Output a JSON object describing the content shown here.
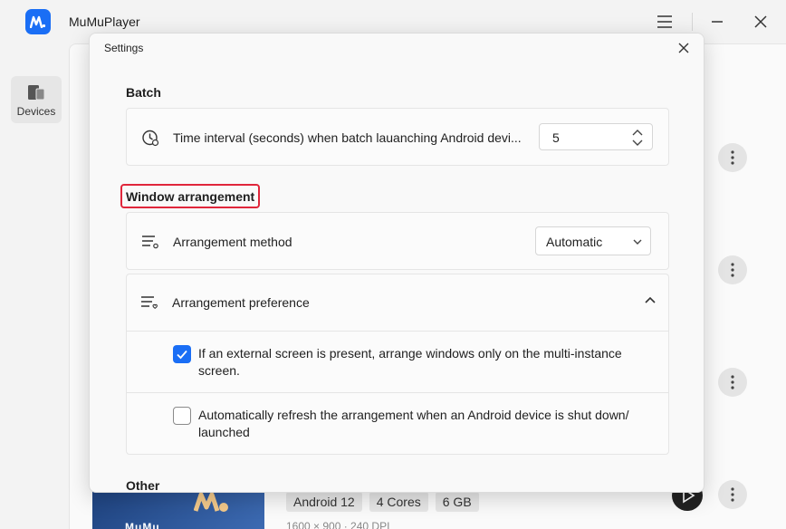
{
  "app": {
    "title": "MuMuPlayer",
    "sidebar": {
      "devices_label": "Devices"
    },
    "device": {
      "chips": [
        "Android 12",
        "4 Cores",
        "6 GB"
      ],
      "meta": "1600 × 900 · 240 DPI",
      "thumb_text": "MuMu"
    }
  },
  "settings": {
    "title": "Settings",
    "batch": {
      "heading": "Batch",
      "interval_label": "Time interval (seconds) when batch lauanching Android devi...",
      "interval_value": "5"
    },
    "window_arrangement": {
      "heading": "Window arrangement",
      "method_label": "Arrangement method",
      "method_value": "Automatic",
      "preference_label": "Arrangement preference",
      "options": [
        {
          "label": "If an external screen is present, arrange windows only on the multi-instance screen.",
          "checked": true
        },
        {
          "label": "Automatically refresh the arrangement when an Android device is shut down/ launched",
          "checked": false
        }
      ]
    },
    "other": {
      "heading": "Other"
    }
  },
  "colors": {
    "accent": "#1a6ef5",
    "highlight": "#e0263b"
  }
}
